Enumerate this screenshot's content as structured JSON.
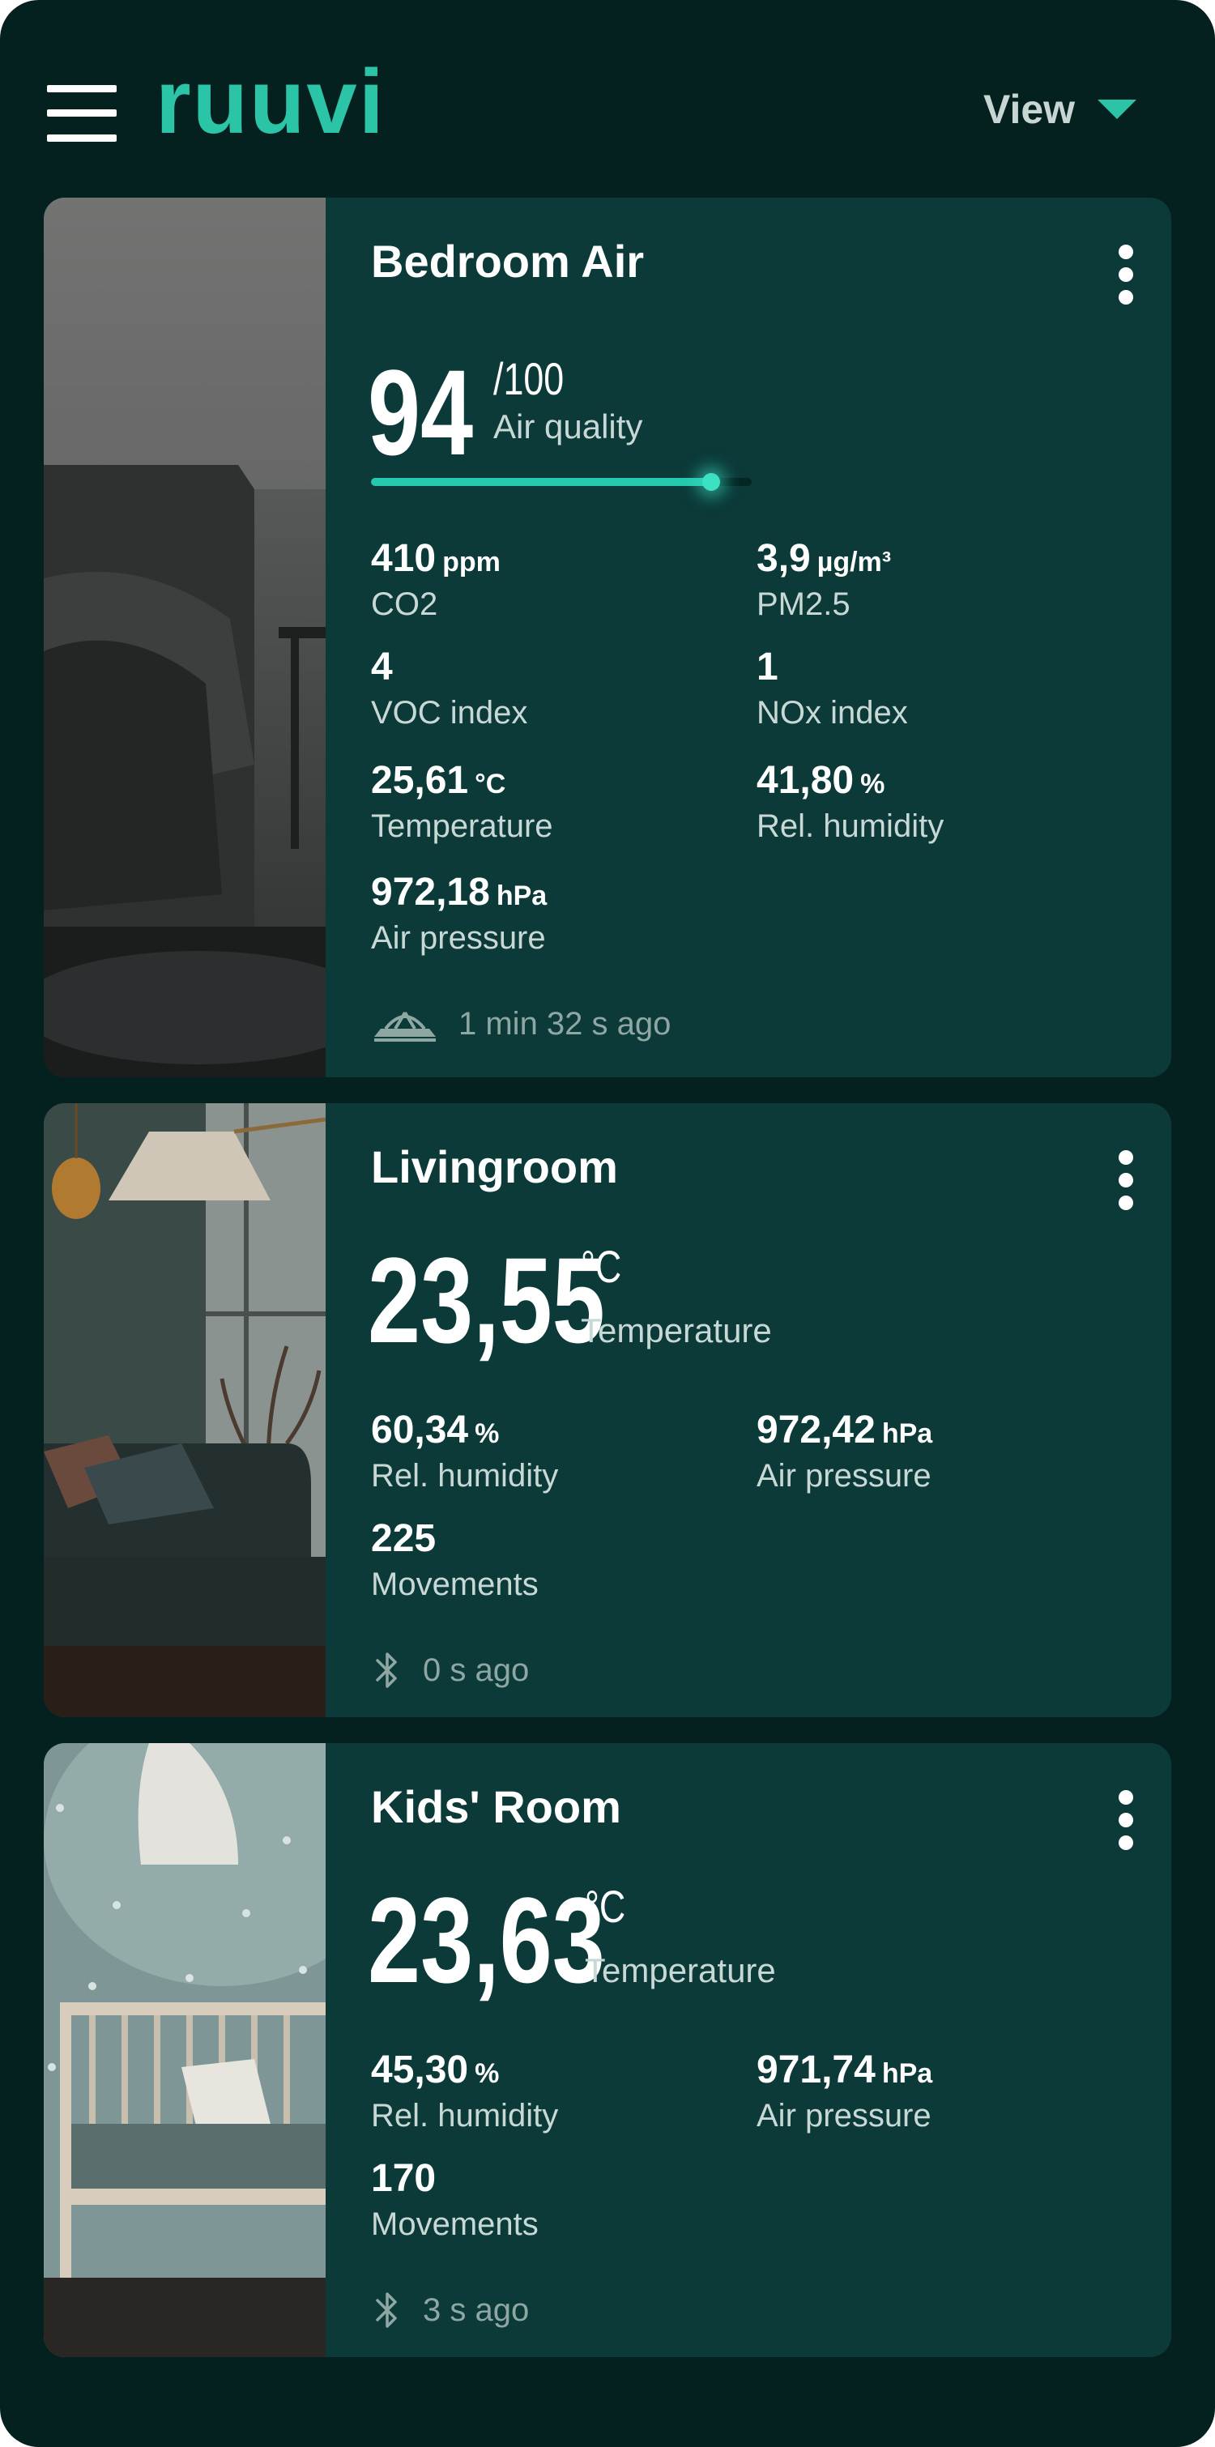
{
  "header": {
    "logo_text": "ruuvi",
    "view_label": "View"
  },
  "colors": {
    "background": "#05211f",
    "card": "#0b3a39",
    "accent": "#2cc4a7",
    "muted_text": "#c8d8d5"
  },
  "cards": [
    {
      "title": "Bedroom Air",
      "air_quality": {
        "value": "94",
        "max": "/100",
        "label": "Air quality",
        "fraction": 0.94
      },
      "metrics": [
        {
          "value": "410",
          "unit": "ppm",
          "label": "CO2"
        },
        {
          "value": "3,9",
          "unit": "µg/m³",
          "label": "PM2.5"
        },
        {
          "value": "4",
          "unit": "",
          "label": "VOC index"
        },
        {
          "value": "1",
          "unit": "",
          "label": "NOx index"
        },
        {
          "value": "25,61",
          "unit": "°C",
          "label": "Temperature"
        },
        {
          "value": "41,80",
          "unit": "%",
          "label": "Rel. humidity"
        },
        {
          "value": "972,18",
          "unit": "hPa",
          "label": "Air pressure"
        }
      ],
      "updated": "1 min 32 s ago",
      "updated_icon": "gateway-icon"
    },
    {
      "title": "Livingroom",
      "main": {
        "value": "23,55",
        "unit": "°C",
        "label": "Temperature"
      },
      "metrics": [
        {
          "value": "60,34",
          "unit": "%",
          "label": "Rel. humidity"
        },
        {
          "value": "972,42",
          "unit": "hPa",
          "label": "Air pressure"
        },
        {
          "value": "225",
          "unit": "",
          "label": "Movements"
        }
      ],
      "updated": "0 s ago",
      "updated_icon": "bluetooth-icon"
    },
    {
      "title": "Kids' Room",
      "main": {
        "value": "23,63",
        "unit": "°C",
        "label": "Temperature"
      },
      "metrics": [
        {
          "value": "45,30",
          "unit": "%",
          "label": "Rel. humidity"
        },
        {
          "value": "971,74",
          "unit": "hPa",
          "label": "Air pressure"
        },
        {
          "value": "170",
          "unit": "",
          "label": "Movements"
        }
      ],
      "updated": "3 s ago",
      "updated_icon": "bluetooth-icon"
    }
  ]
}
